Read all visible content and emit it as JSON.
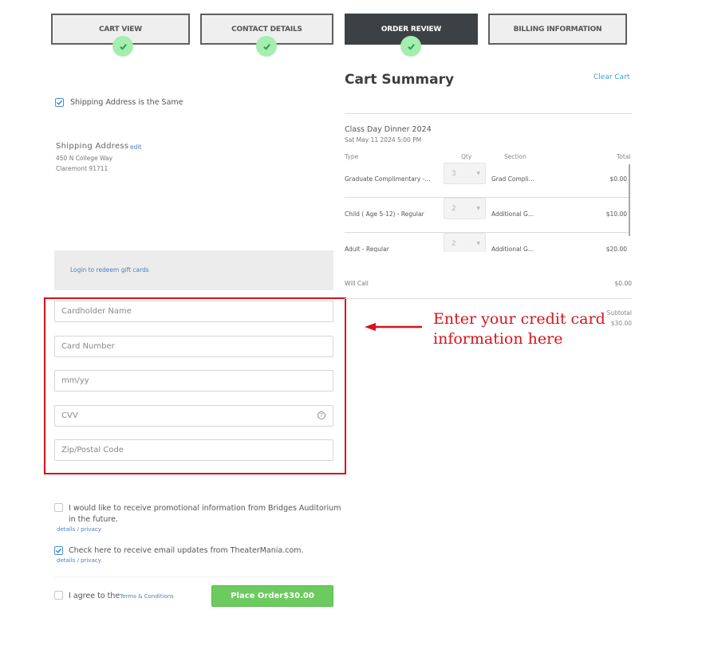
{
  "steps": [
    {
      "label": "CART VIEW",
      "completed": true,
      "active": false
    },
    {
      "label": "CONTACT DETAILS",
      "completed": true,
      "active": false
    },
    {
      "label": "ORDER REVIEW",
      "completed": true,
      "active": true
    },
    {
      "label": "BILLING INFORMATION",
      "completed": false,
      "active": false
    }
  ],
  "shipping": {
    "same_checkbox_label": "Shipping Address is the Same",
    "same_checked": true,
    "heading": "Shipping Address",
    "edit_link": "edit",
    "line1": "450 N College Way",
    "line2": "Claremont 91711"
  },
  "gift_card": {
    "link": "Login to redeem gift cards"
  },
  "payment_form": {
    "cardholder_placeholder": "Cardholder Name",
    "card_number_placeholder": "Card Number",
    "expiry_placeholder": "mm/yy",
    "cvv_placeholder": "CVV",
    "cvv_help_icon": "?",
    "zip_placeholder": "Zip/Postal Code"
  },
  "opt_ins": [
    {
      "label": "I would like to receive promotional information from Bridges Auditorium",
      "label_cont": "in the future.",
      "checked": false,
      "details": "details",
      "sep": "/",
      "privacy": "privacy"
    },
    {
      "label": "Check here to receive email updates from TheaterMania.com.",
      "checked": true,
      "details": "details",
      "sep": "/",
      "privacy": "privacy"
    }
  ],
  "terms": {
    "prefix": "I agree to the",
    "link": "Terms & Conditions",
    "checked": false
  },
  "place_order": {
    "label": "Place Order",
    "amount": "$30.00"
  },
  "cart": {
    "title": "Cart Summary",
    "clear_link": "Clear Cart",
    "event_name": "Class Day Dinner 2024",
    "event_date": "Sat May 11 2024 5:00 PM",
    "columns": {
      "type": "Type",
      "qty": "Qty",
      "section": "Section",
      "total": "Total"
    },
    "rows": [
      {
        "type": "Graduate Complimentary -...",
        "qty": "3",
        "section": "Grad Compli...",
        "total": "$0.00"
      },
      {
        "type": "Child ( Age 5-12) - Regular",
        "qty": "2",
        "section": "Additional G...",
        "total": "$10.00"
      },
      {
        "type": "Adult - Regular",
        "qty": "2",
        "section": "Additional G...",
        "total": "$20.00"
      }
    ],
    "delivery": {
      "label": "Will Call",
      "amount": "$0.00"
    },
    "subtotal_label": "Subtotal",
    "subtotal_amount": "$30.00"
  },
  "annotation": {
    "line1": "Enter your credit card",
    "line2": "information here"
  },
  "colors": {
    "accent_red": "#d9121a",
    "button_green": "#6ccb5f",
    "check_green": "#a4eeb0",
    "active_step": "#3b4145",
    "link_blue": "#4a7fc5"
  }
}
